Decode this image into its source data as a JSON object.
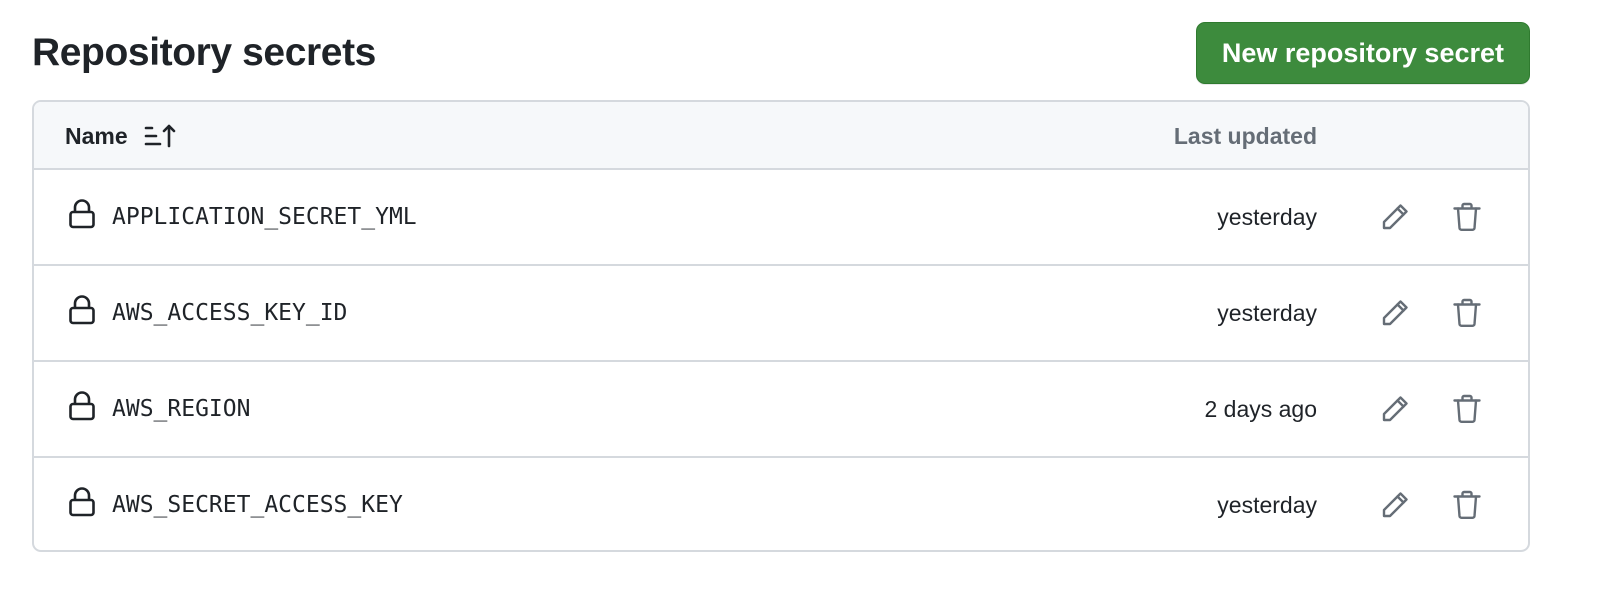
{
  "page": {
    "title": "Repository secrets"
  },
  "actions": {
    "new_secret_label": "New repository secret"
  },
  "table": {
    "columns": {
      "name": "Name",
      "last_updated": "Last updated"
    },
    "sort_icon": "sort-ascending-icon",
    "rows": [
      {
        "name": "APPLICATION_SECRET_YML",
        "updated": "yesterday",
        "icon": "lock-icon"
      },
      {
        "name": "AWS_ACCESS_KEY_ID",
        "updated": "yesterday",
        "icon": "lock-icon"
      },
      {
        "name": "AWS_REGION",
        "updated": "2 days ago",
        "icon": "lock-icon"
      },
      {
        "name": "AWS_SECRET_ACCESS_KEY",
        "updated": "yesterday",
        "icon": "lock-icon"
      }
    ],
    "row_actions": {
      "edit_icon": "pencil-icon",
      "delete_icon": "trash-icon"
    }
  },
  "colors": {
    "primary_button": "#3d8b3d",
    "border": "#d5d9de",
    "header_bg": "#f6f8fa",
    "muted_text": "#656d76",
    "icon_gray": "#656d76"
  }
}
